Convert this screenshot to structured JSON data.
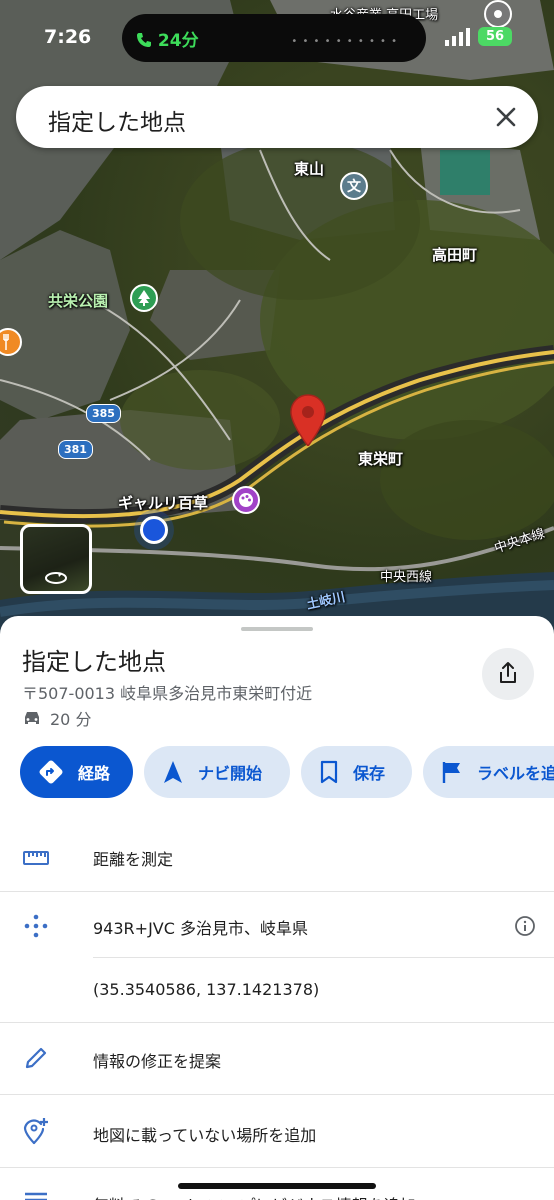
{
  "status_bar": {
    "time": "7:26",
    "call_duration": "24分",
    "battery": "56"
  },
  "search": {
    "query": "指定した地点",
    "close_icon": "close-icon"
  },
  "map": {
    "labels": {
      "higashiyama": "東山",
      "takadacho": "高田町",
      "kyoeikoen": "共栄公園",
      "toeicho": "東栄町",
      "gallery": "ギャルリ百草",
      "chuo_line_1": "中央本線",
      "chuo_line_2": "中央西線",
      "river": "土岐川",
      "factory": "水谷産業 高田工場"
    },
    "route_shields": {
      "r385": "385",
      "r381": "381"
    },
    "poi_school_glyph": "文",
    "pin_color": "#d93025",
    "location_dot_color": "#1a56db"
  },
  "place": {
    "title": "指定した地点",
    "address": "〒507-0013 岐阜県多治見市東栄町付近",
    "drive_time": "20 分"
  },
  "actions": {
    "route": "経路",
    "navigate": "ナビ開始",
    "save": "保存",
    "label": "ラベルを追加"
  },
  "list": {
    "measure": "距離を測定",
    "plus_code": "943R+JVC 多治見市、岐阜県",
    "coordinates": "(35.3540586, 137.1421378)",
    "suggest_edit": "情報の修正を提案",
    "add_place": "地図に載っていない場所を追加",
    "bottom_cut": "無料で Google マップにビジネス情報を追加"
  },
  "colors": {
    "accent": "#0b57d0",
    "chip_bg": "#dce7f5"
  }
}
